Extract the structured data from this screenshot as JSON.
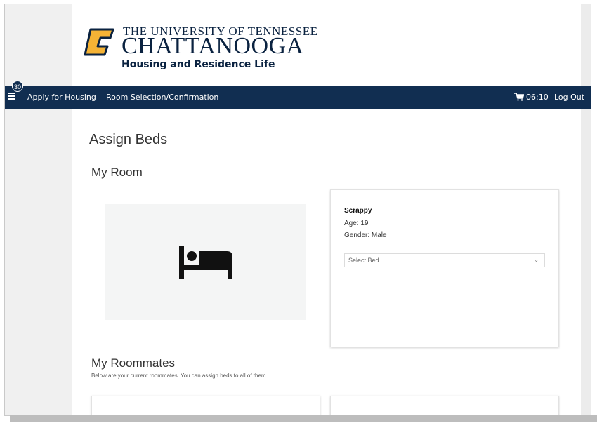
{
  "branding": {
    "line1": "THE UNIVERSITY OF TENNESSEE",
    "line2": "CHATTANOOGA",
    "subtitle": "Housing and Residence Life",
    "logo_colors": {
      "gold": "#f5b335",
      "navy": "#0a2240"
    }
  },
  "nav": {
    "badge_count": "30",
    "links": [
      "Apply for Housing",
      "Room Selection/Confirmation"
    ],
    "timer": "06:10",
    "logout": "Log Out",
    "bg_color": "#112e51"
  },
  "page": {
    "title": "Assign Beds",
    "my_room_heading": "My Room",
    "room_image_icon": "bed-icon"
  },
  "occupant": {
    "name": "Scrappy",
    "age": "Age: 19",
    "gender": "Gender: Male",
    "select_placeholder": "Select Bed"
  },
  "roommates": {
    "heading": "My Roommates",
    "description": "Below are your current roommates. You can assign beds to all of them."
  }
}
